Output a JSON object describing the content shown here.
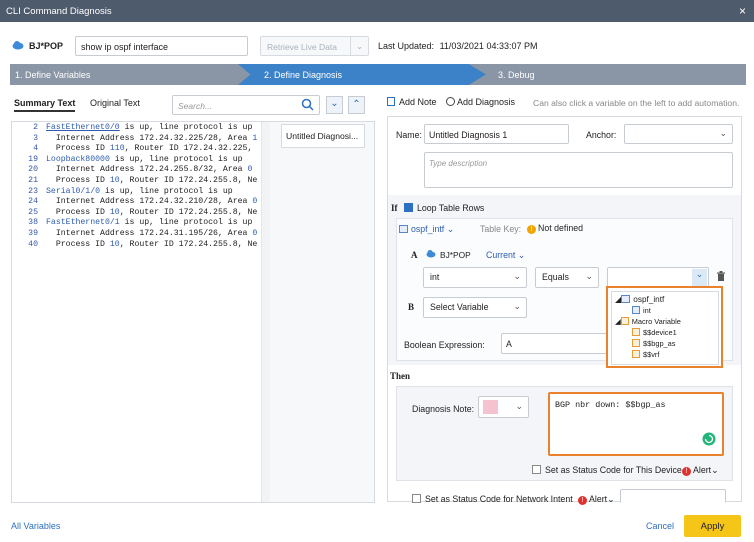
{
  "window": {
    "title": "CLI Command Diagnosis",
    "close": "×"
  },
  "header": {
    "device": "BJ*POP",
    "command": "show ip ospf interface",
    "retrieve_label": "Retrieve Live Data",
    "last_updated_label": "Last Updated:",
    "last_updated_value": "11/03/2021 04:33:07 PM"
  },
  "steps": [
    "1. Define Variables",
    "2. Define Diagnosis",
    "3. Debug"
  ],
  "left": {
    "tabs": [
      "Summary Text",
      "Original Text"
    ],
    "search_placeholder": "Search...",
    "lines": [
      {
        "n": "2",
        "parts": [
          {
            "t": "FastEthernet0/0",
            "c": "blue"
          },
          {
            "t": " is up, line protocol is up"
          }
        ]
      },
      {
        "n": "3",
        "parts": [
          {
            "t": "  Internet Address 172.24.32.225/28, Area "
          },
          {
            "t": "1",
            "c": "blue"
          }
        ]
      },
      {
        "n": "4",
        "parts": [
          {
            "t": "  Process ID "
          },
          {
            "t": "110",
            "c": "blue"
          },
          {
            "t": ", Router ID 172.24.32.225,"
          }
        ]
      },
      {
        "n": "19",
        "parts": [
          {
            "t": "Loopback80000",
            "c": "blue"
          },
          {
            "t": " is up, line protocol is up"
          }
        ]
      },
      {
        "n": "20",
        "parts": [
          {
            "t": "  Internet Address 172.24.255.8/32, Area "
          },
          {
            "t": "0",
            "c": "blue"
          }
        ]
      },
      {
        "n": "21",
        "parts": [
          {
            "t": "  Process ID "
          },
          {
            "t": "10",
            "c": "blue"
          },
          {
            "t": ", Router ID 172.24.255.8, Ne"
          }
        ]
      },
      {
        "n": "23",
        "parts": [
          {
            "t": "Serial0/1/0",
            "c": "blue"
          },
          {
            "t": " is up, line protocol is up"
          }
        ]
      },
      {
        "n": "24",
        "parts": [
          {
            "t": "  Internet Address 172.24.32.210/28, Area "
          },
          {
            "t": "0",
            "c": "blue"
          }
        ]
      },
      {
        "n": "25",
        "parts": [
          {
            "t": "  Process ID "
          },
          {
            "t": "10",
            "c": "blue"
          },
          {
            "t": ", Router ID 172.24.255.8, Ne"
          }
        ]
      },
      {
        "n": "38",
        "parts": [
          {
            "t": "FastEthernet0/1",
            "c": "blue"
          },
          {
            "t": " is up, line protocol is up"
          }
        ]
      },
      {
        "n": "39",
        "parts": [
          {
            "t": "  Internet Address 172.24.31.195/26, Area "
          },
          {
            "t": "0",
            "c": "blue"
          }
        ]
      },
      {
        "n": "40",
        "parts": [
          {
            "t": "  Process ID "
          },
          {
            "t": "10",
            "c": "blue"
          },
          {
            "t": ", Router ID 172.24.255.8, Ne"
          }
        ]
      }
    ],
    "diagnosis_item": "Untitled Diagnosi..."
  },
  "right": {
    "add_note": "Add Note",
    "add_diagnosis": "Add Diagnosis",
    "hint": "Can also click a variable on the left to add automation.",
    "name_label": "Name:",
    "name_value": "Untitled Diagnosis 1",
    "anchor_label": "Anchor:",
    "desc_placeholder": "Type description",
    "if_label": "If",
    "loop_label": "Loop Table Rows",
    "table_name": "ospf_intf",
    "table_key_label": "Table Key:",
    "table_key_value": "Not defined",
    "a_label": "A",
    "a_device": "BJ*POP",
    "a_current": "Current",
    "a_var": "int",
    "operator": "Equals",
    "b_label": "B",
    "b_placeholder": "Select Variable",
    "bool_label": "Boolean Expression:",
    "bool_value": "A",
    "then_label": "Then",
    "diag_note_label": "Diagnosis Note:",
    "note_text": "BGP nbr down: $$bgp_as",
    "status_device": "Set as Status Code for This Device",
    "alert": "Alert",
    "status_intent": "Set as Status Code for Network Intent",
    "dropdown": {
      "table": "ospf_intf",
      "table_child": "int",
      "macro": "Macro Variable",
      "macros": [
        "$$device1",
        "$$bgp_as",
        "$$vrf"
      ]
    }
  },
  "footer": {
    "all_vars": "All Variables",
    "cancel": "Cancel",
    "apply": "Apply"
  },
  "colors": {
    "accent": "#3c82c8",
    "apply": "#f5c518",
    "highlight": "#e8822d"
  }
}
